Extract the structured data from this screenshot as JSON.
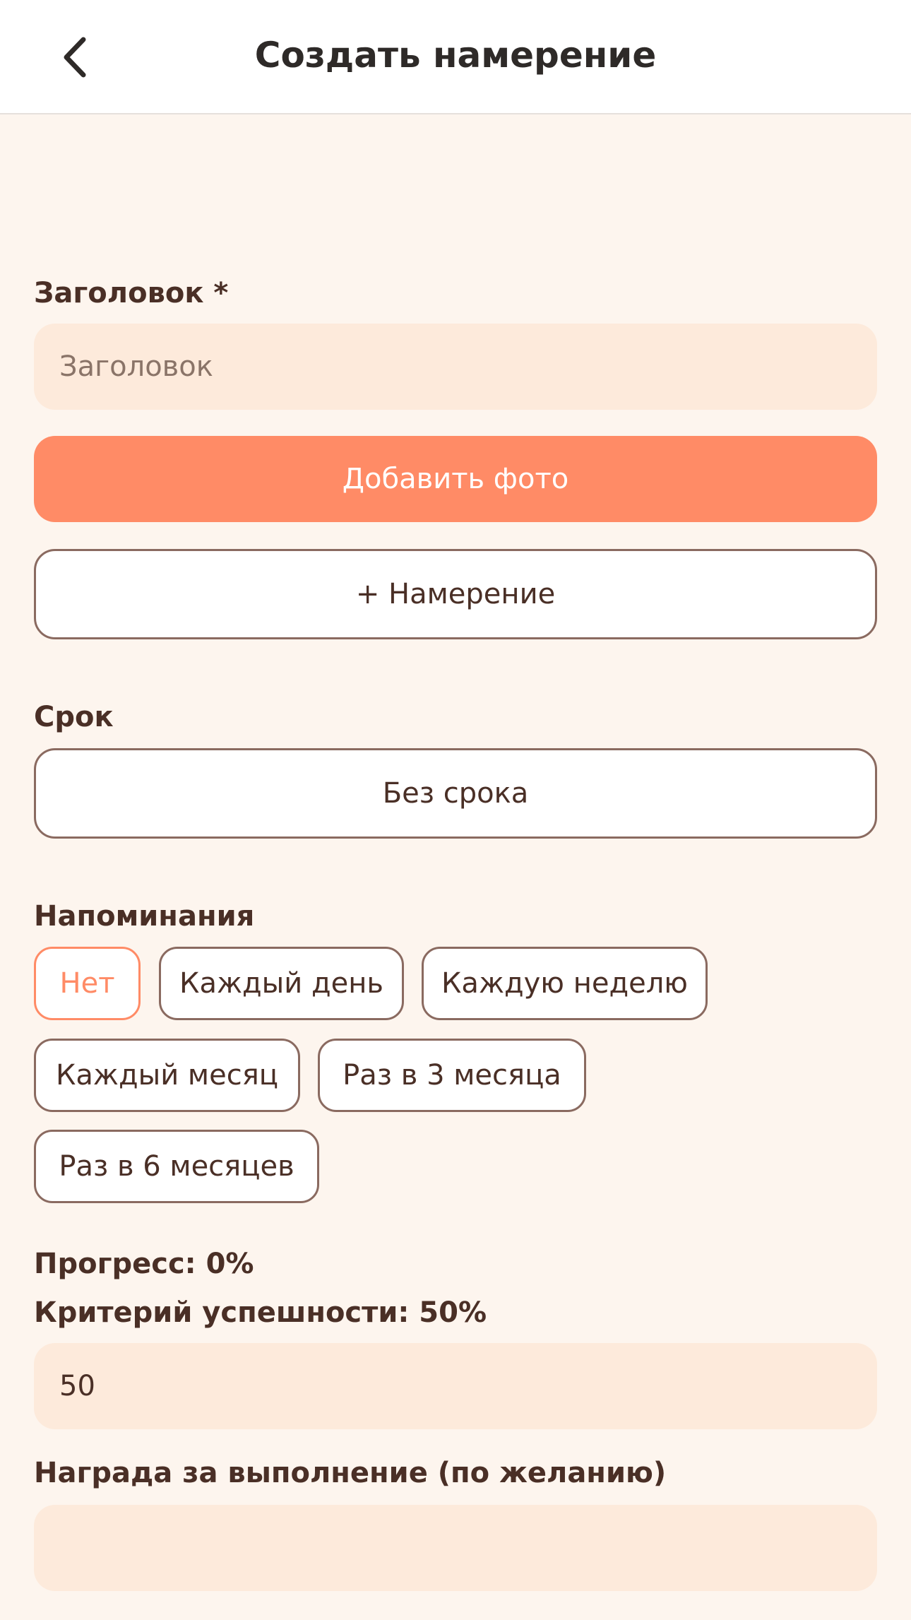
{
  "header": {
    "title": "Создать намерение"
  },
  "form": {
    "title_label": "Заголовок *",
    "title_placeholder": "Заголовок",
    "add_photo_label": "Добавить фото",
    "add_intention_label": "+ Намерение",
    "deadline_label": "Срок",
    "deadline_value": "Без срока",
    "reminders_label": "Напоминания",
    "reminder_options": [
      "Нет",
      "Каждый день",
      "Каждую неделю",
      "Каждый месяц",
      "Раз в 3 месяца",
      "Раз в 6 месяцев"
    ],
    "reminder_selected": "Нет",
    "progress_label": "Прогресс: 0%",
    "success_label": "Критерий успешности: 50%",
    "success_value": "50",
    "reward_label": "Награда за выполнение (по желанию)",
    "reward_value": ""
  },
  "colors": {
    "accent": "#ff8b66",
    "background": "#fdf5ee",
    "input_bg": "#fdeadb",
    "text": "#4a2f26",
    "border": "#8a6a60"
  },
  "icons": {
    "back": "chevron-left-icon"
  }
}
